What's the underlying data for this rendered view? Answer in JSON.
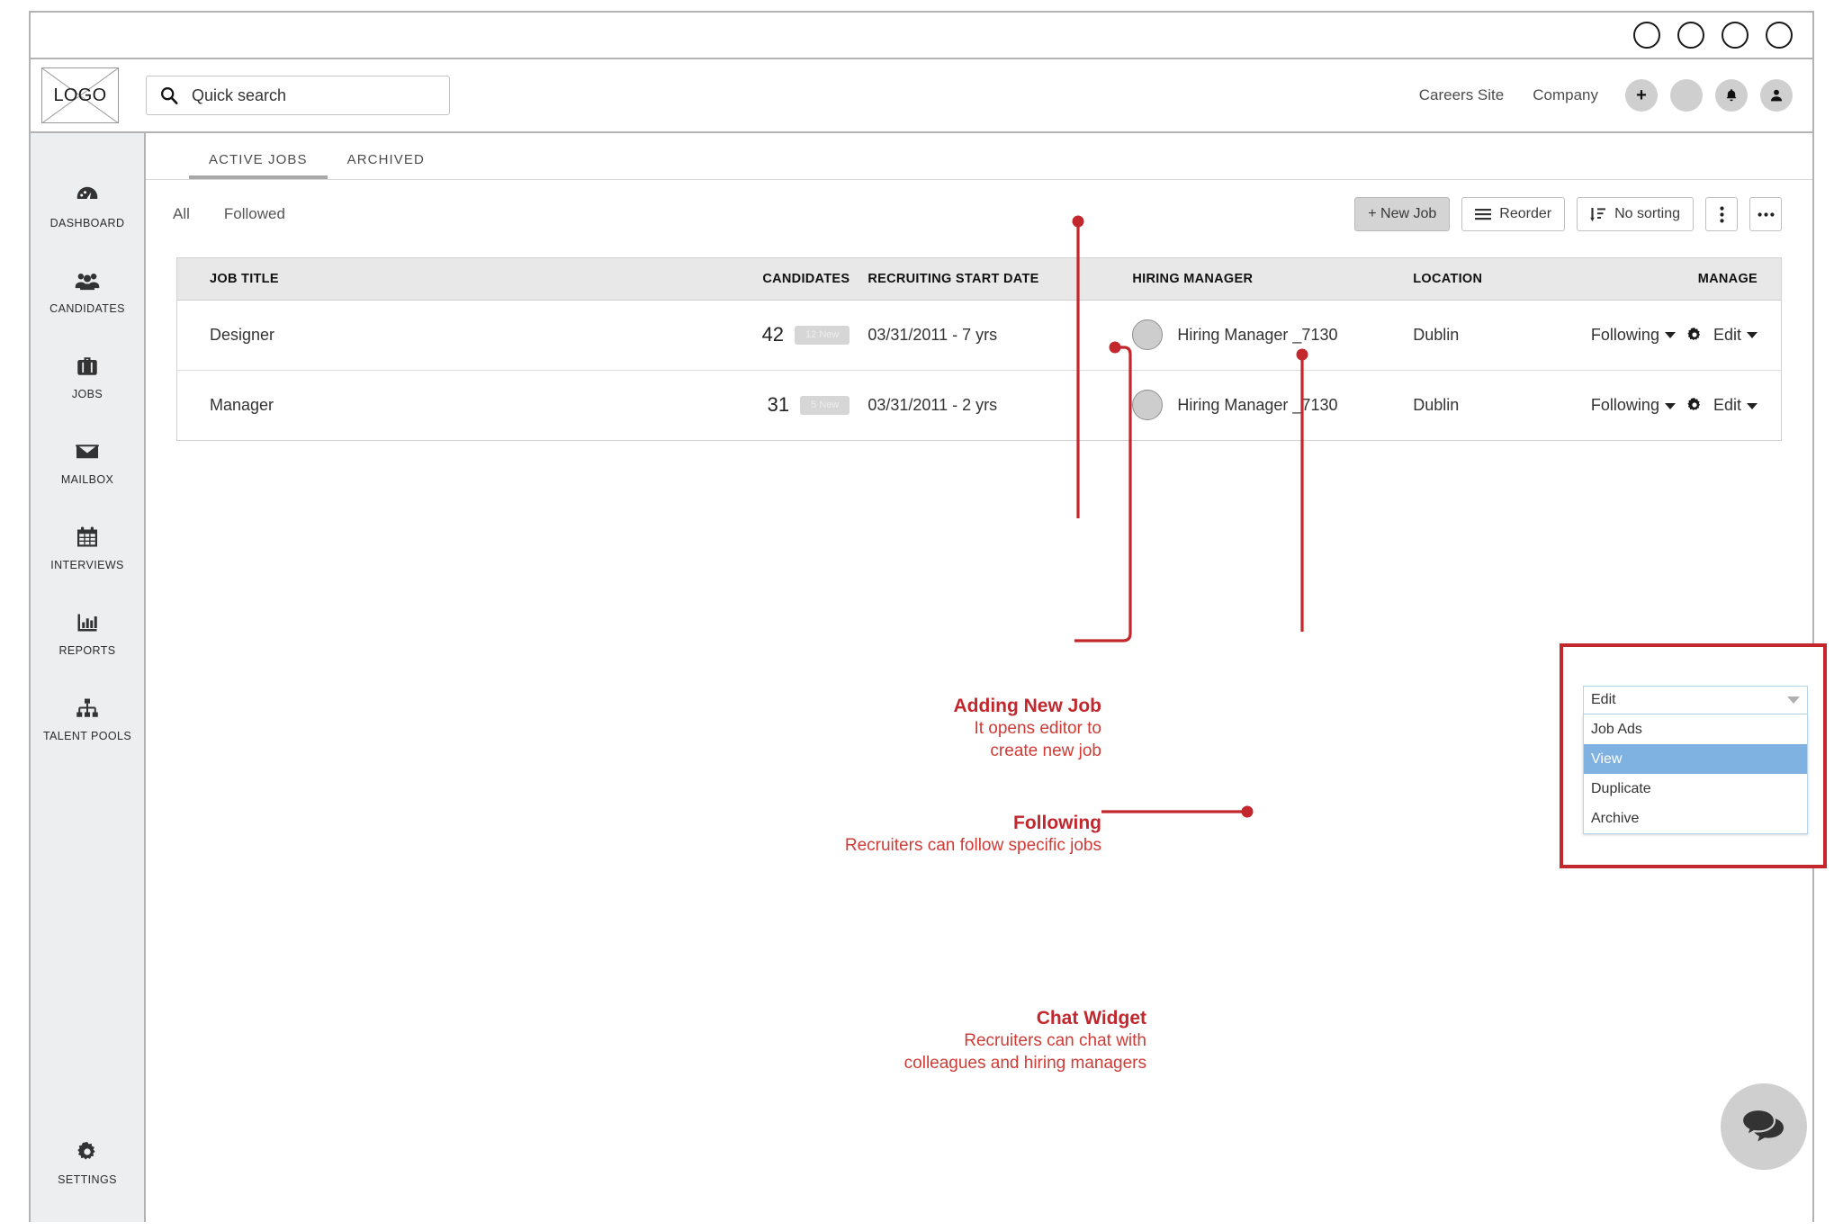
{
  "window": {
    "chrome_dots": [
      "dot-1",
      "dot-2",
      "dot-3",
      "dot-4"
    ]
  },
  "header": {
    "logo_text": "LOGO",
    "search_placeholder": "Quick search",
    "search_value": "",
    "search_icon": "search-icon",
    "links": [
      {
        "label": "Careers Site"
      },
      {
        "label": "Company"
      }
    ],
    "actions": [
      {
        "name": "add-button",
        "glyph": "+"
      },
      {
        "name": "blank-avatar-button",
        "glyph": ""
      },
      {
        "name": "notifications-button",
        "glyph": "bell-icon"
      },
      {
        "name": "user-account-button",
        "glyph": "user-icon"
      }
    ]
  },
  "sidebar": {
    "items": [
      {
        "label": "DASHBOARD",
        "icon": "dashboard-icon"
      },
      {
        "label": "CANDIDATES",
        "icon": "people-icon"
      },
      {
        "label": "JOBS",
        "icon": "briefcase-icon"
      },
      {
        "label": "MAILBOX",
        "icon": "envelope-icon"
      },
      {
        "label": "INTERVIEWS",
        "icon": "calendar-icon"
      },
      {
        "label": "REPORTS",
        "icon": "bar-chart-icon"
      },
      {
        "label": "TALENT POOLS",
        "icon": "org-chart-icon"
      }
    ],
    "settings": {
      "label": "SETTINGS",
      "icon": "gear-icon"
    }
  },
  "tabs": [
    {
      "label": "ACTIVE JOBS",
      "active": true
    },
    {
      "label": "ARCHIVED",
      "active": false
    }
  ],
  "toolbar": {
    "filters": [
      {
        "label": "All"
      },
      {
        "label": "Followed"
      }
    ],
    "new_job_label": "+ New Job",
    "reorder_label": "Reorder",
    "sorting_label": "No sorting",
    "kebab_label": "⋮",
    "ellipsis_label": "•••"
  },
  "table": {
    "columns": [
      "JOB TITLE",
      "CANDIDATES",
      "RECRUITING START DATE",
      "HIRING MANAGER",
      "LOCATION",
      "",
      "MANAGE"
    ],
    "rows": [
      {
        "title": "Designer",
        "candidates": "42",
        "new_badge": "12 New",
        "start_date": "03/31/2011 - 7 yrs",
        "hiring_manager": "Hiring Manager _7130",
        "location": "Dublin",
        "following_label": "Following",
        "edit_label": "Edit"
      },
      {
        "title": "Manager",
        "candidates": "31",
        "new_badge": "5 New",
        "start_date": "03/31/2011 - 2 yrs",
        "hiring_manager": "Hiring Manager _7130",
        "location": "Dublin",
        "following_label": "Following",
        "edit_label": "Edit"
      }
    ]
  },
  "dropdown": {
    "selected": "Edit",
    "options": [
      {
        "label": "Job Ads",
        "highlighted": false
      },
      {
        "label": "View",
        "highlighted": true
      },
      {
        "label": "Duplicate",
        "highlighted": false
      },
      {
        "label": "Archive",
        "highlighted": false
      }
    ]
  },
  "annotations": [
    {
      "name": "annotation-adding-new-job",
      "title": "Adding New Job",
      "desc_line1": "It opens editor to",
      "desc_line2": "create new job"
    },
    {
      "name": "annotation-following",
      "title": "Following",
      "desc_line1": "Recruiters can follow specific jobs",
      "desc_line2": ""
    },
    {
      "name": "annotation-chat-widget",
      "title": "Chat Widget",
      "desc_line1": "Recruiters can chat with",
      "desc_line2": "colleagues and hiring managers"
    }
  ],
  "chat_widget": {
    "icon": "chat-bubbles-icon"
  },
  "colors": {
    "annotation_red": "#c1272d",
    "annotation_red_light": "#cf3b36",
    "sidebar_bg": "#eceef0",
    "table_header_bg": "#e8e8e8",
    "dropdown_highlight": "#7fb2e0"
  }
}
